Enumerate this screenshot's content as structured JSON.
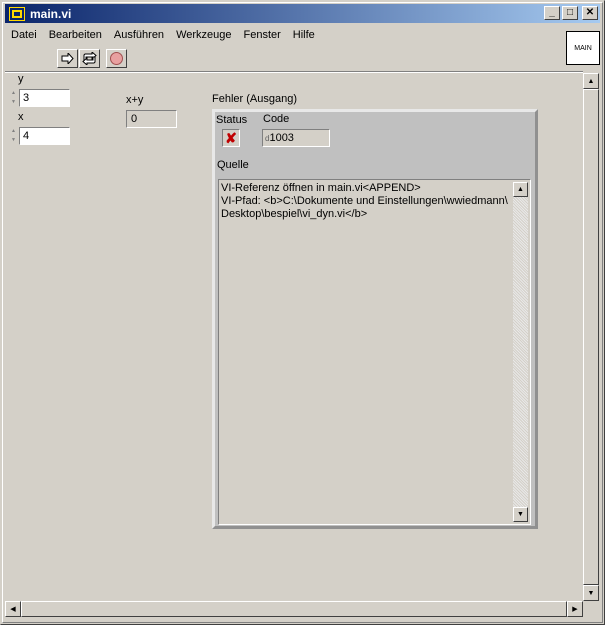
{
  "window": {
    "title": "main.vi"
  },
  "menu": [
    "Datei",
    "Bearbeiten",
    "Ausführen",
    "Werkzeuge",
    "Fenster",
    "Hilfe"
  ],
  "vi_icon_text": "MAIN",
  "controls": {
    "y": {
      "label": "y",
      "value": "3"
    },
    "x": {
      "label": "x",
      "value": "4"
    },
    "sum": {
      "label": "x+y",
      "value": "0"
    }
  },
  "error_out": {
    "label": "Fehler (Ausgang)",
    "status_label": "Status",
    "status_glyph": "✘",
    "code_label": "Code",
    "code_prefix": "d",
    "code_value": "1003",
    "source_label": "Quelle",
    "source_text": "VI-Referenz öffnen in main.vi<APPEND>\nVI-Pfad: <b>C:\\Dokumente und Einstellungen\\wwiedmann\\\nDesktop\\bespiel\\vi_dyn.vi</b>"
  }
}
